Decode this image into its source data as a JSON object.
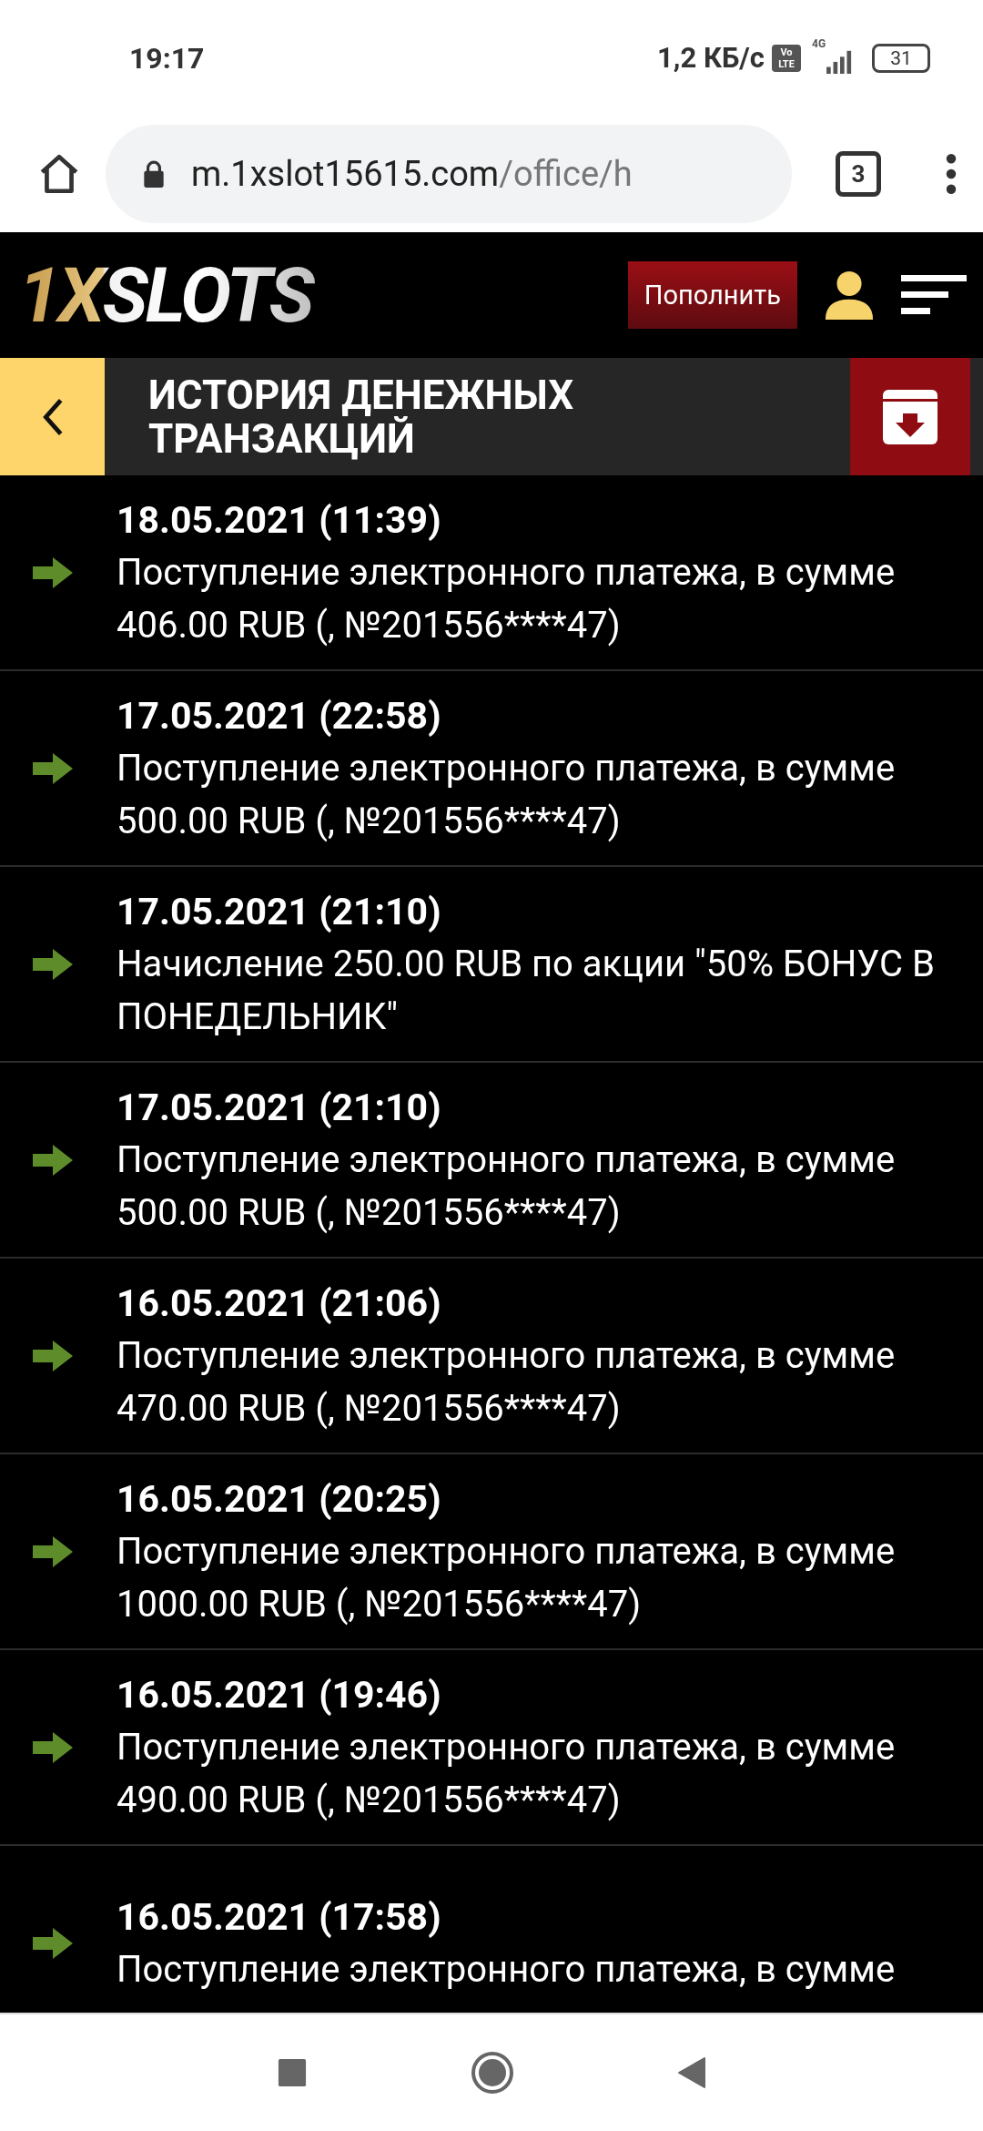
{
  "status_bar": {
    "time": "19:17",
    "speed": "1,2 КБ/с",
    "volte": "Vo LTE",
    "network": "4G",
    "battery": "31"
  },
  "browser": {
    "url_host": "m.1xslot15615.com",
    "url_path": "/office/h",
    "tabs_count": "3"
  },
  "header": {
    "logo_accent": "1X",
    "logo_text": "SLOTS",
    "deposit_button": "Пополнить"
  },
  "title_bar": {
    "title": "ИСТОРИЯ ДЕНЕЖНЫХ ТРАНЗАКЦИЙ"
  },
  "transactions": [
    {
      "date": "18.05.2021 (11:39)",
      "description": "Поступление электронного платежа, в сумме 406.00 RUB (, №201556****47)"
    },
    {
      "date": "17.05.2021 (22:58)",
      "description": "Поступление электронного платежа, в сумме 500.00 RUB (, №201556****47)"
    },
    {
      "date": "17.05.2021 (21:10)",
      "description": "Начисление 250.00 RUB по акции \"50% БОНУС В ПОНЕДЕЛЬНИК\""
    },
    {
      "date": "17.05.2021 (21:10)",
      "description": "Поступление электронного платежа, в сумме 500.00 RUB (, №201556****47)"
    },
    {
      "date": "16.05.2021 (21:06)",
      "description": "Поступление электронного платежа, в сумме 470.00 RUB (, №201556****47)"
    },
    {
      "date": "16.05.2021 (20:25)",
      "description": "Поступление электронного платежа, в сумме 1000.00 RUB (, №201556****47)"
    },
    {
      "date": "16.05.2021 (19:46)",
      "description": "Поступление электронного платежа, в сумме 490.00 RUB (, №201556****47)"
    },
    {
      "date": "16.05.2021 (17:58)",
      "description": "Поступление электронного платежа, в сумме"
    }
  ]
}
